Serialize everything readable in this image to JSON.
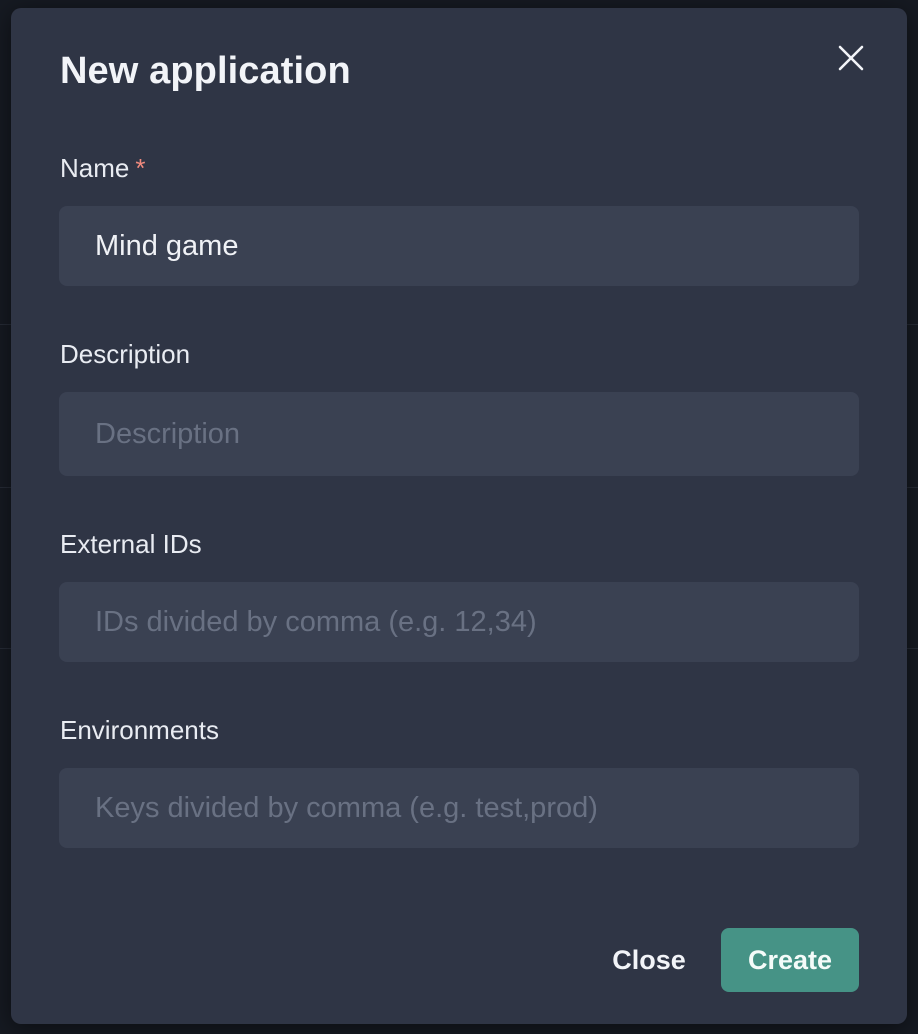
{
  "modal": {
    "title": "New application",
    "close_icon": "close-icon"
  },
  "fields": {
    "name": {
      "label": "Name",
      "required_mark": "*",
      "value": "Mind game",
      "placeholder": ""
    },
    "description": {
      "label": "Description",
      "value": "",
      "placeholder": "Description"
    },
    "external_ids": {
      "label": "External IDs",
      "value": "",
      "placeholder": "IDs divided by comma (e.g. 12,34)"
    },
    "environments": {
      "label": "Environments",
      "value": "",
      "placeholder": "Keys divided by comma (e.g. test,prod)"
    }
  },
  "actions": {
    "close_label": "Close",
    "create_label": "Create"
  },
  "colors": {
    "accent": "#469386",
    "required": "#f08a7e",
    "modal_bg": "#2f3545",
    "input_bg": "#3a4152"
  }
}
